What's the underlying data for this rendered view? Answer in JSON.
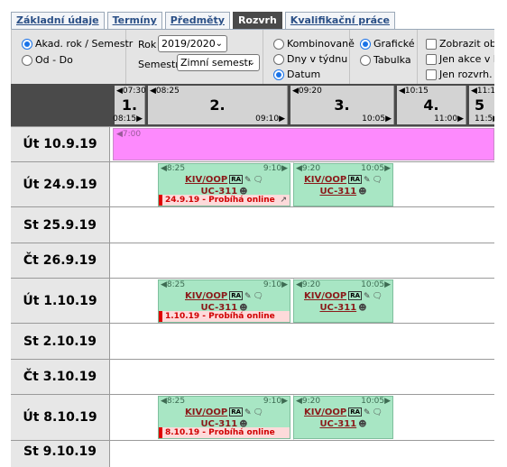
{
  "tabs": [
    {
      "label": "Základní údaje",
      "active": false
    },
    {
      "label": "Termíny",
      "active": false
    },
    {
      "label": "Předměty",
      "active": false
    },
    {
      "label": "Rozvrh",
      "active": true
    },
    {
      "label": "Kvalifikační práce",
      "active": false
    }
  ],
  "filters": {
    "period_mode": {
      "options": [
        {
          "label": "Akad. rok / Semestr",
          "selected": true
        },
        {
          "label": "Od - Do",
          "selected": false
        }
      ]
    },
    "year_label": "Rok",
    "year_value": "2019/2020",
    "semester_label": "Semestr",
    "semester_value": "Zimní semestr",
    "view_by": {
      "options": [
        {
          "label": "Kombinovaně",
          "selected": false
        },
        {
          "label": "Dny v týdnu",
          "selected": false
        },
        {
          "label": "Datum",
          "selected": true
        }
      ]
    },
    "display_mode": {
      "options": [
        {
          "label": "Grafické",
          "selected": true
        },
        {
          "label": "Tabulka",
          "selected": false
        }
      ]
    },
    "checkboxes": [
      {
        "label": "Zobrazit obs",
        "checked": false
      },
      {
        "label": "Jen akce v b",
        "checked": false
      },
      {
        "label": "Jen rozvrh. a",
        "checked": false
      }
    ]
  },
  "header": {
    "periods": [
      {
        "num": "1.",
        "start": "07:30",
        "end": "08:15"
      },
      {
        "num": "2.",
        "start": "08:25",
        "end": "09:10"
      },
      {
        "num": "3.",
        "start": "09:20",
        "end": "10:05"
      },
      {
        "num": "4.",
        "start": "10:15",
        "end": "11:00"
      },
      {
        "num": "5",
        "start": "11:1",
        "end": "11:5"
      }
    ]
  },
  "days": [
    {
      "label": "Út 10.9.19",
      "allday": {
        "time": "7:00"
      }
    },
    {
      "label": "Út 24.9.19",
      "events": [
        {
          "start": "8:25",
          "end": "9:10",
          "code": "KIV/OOP",
          "room": "UC-311",
          "note": "24.9.19 - Probíhá online"
        },
        {
          "start": "9:20",
          "end": "10:05",
          "code": "KIV/OOP",
          "room": "UC-311"
        }
      ]
    },
    {
      "label": "St 25.9.19"
    },
    {
      "label": "Čt 26.9.19"
    },
    {
      "label": "Út 1.10.19",
      "events": [
        {
          "start": "8:25",
          "end": "9:10",
          "code": "KIV/OOP",
          "room": "UC-311",
          "note": "1.10.19 - Probíhá online"
        },
        {
          "start": "9:20",
          "end": "10:05",
          "code": "KIV/OOP",
          "room": "UC-311"
        }
      ]
    },
    {
      "label": "St 2.10.19"
    },
    {
      "label": "Čt 3.10.19"
    },
    {
      "label": "Út 8.10.19",
      "events": [
        {
          "start": "8:25",
          "end": "9:10",
          "code": "KIV/OOP",
          "room": "UC-311",
          "note": "8.10.19 - Probíhá online"
        },
        {
          "start": "9:20",
          "end": "10:05",
          "code": "KIV/OOP",
          "room": "UC-311"
        }
      ]
    },
    {
      "label": "St 9.10.19"
    }
  ],
  "badge_text": "RA",
  "icons": {
    "comment": "speech-bubble-icon",
    "chat": "chat-bubble-icon",
    "teacher": "person-icon",
    "external": "external-link-icon"
  },
  "colors": {
    "event_bg": "#a8e6c4",
    "allday_bg": "#fd8afd",
    "online_note_bg": "#fddada",
    "online_note_accent": "#e00000",
    "header_bg": "#4a4a4a",
    "tab_active_bg": "#4a4a4a"
  }
}
